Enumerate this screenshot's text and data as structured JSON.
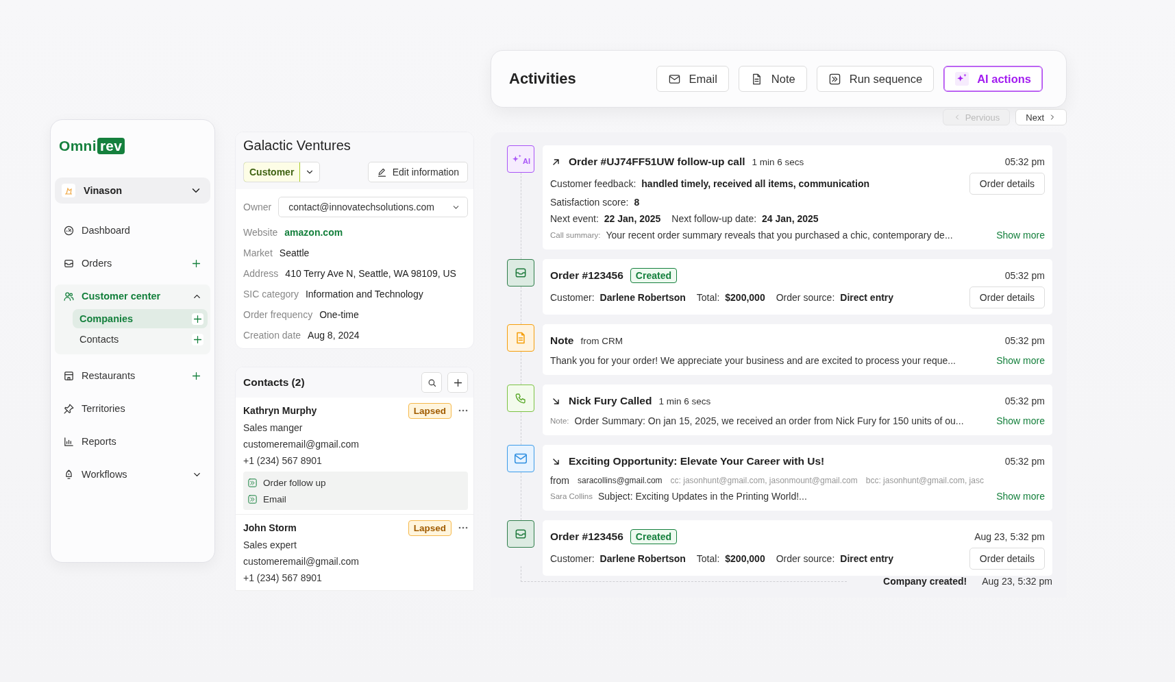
{
  "sidebar": {
    "logo": {
      "part_1": "Omni",
      "part_2": "rev"
    },
    "workspace": {
      "name": "Vinason"
    },
    "items": [
      {
        "label": "Dashboard",
        "selected": false,
        "addable": false
      },
      {
        "label": "Orders",
        "selected": false,
        "addable": true
      },
      {
        "label": "Customer center",
        "selected": true,
        "addable": false,
        "expanded": true,
        "children": [
          {
            "label": "Companies",
            "selected": true,
            "addable": true
          },
          {
            "label": "Contacts",
            "selected": false,
            "addable": true
          }
        ]
      },
      {
        "label": "Restaurants",
        "selected": false,
        "addable": true
      },
      {
        "label": "Territories",
        "selected": false,
        "addable": false
      },
      {
        "label": "Reports",
        "selected": false,
        "addable": false
      },
      {
        "label": "Workflows",
        "selected": false,
        "addable": false,
        "expanded": false
      }
    ]
  },
  "company": {
    "title": "Galactic Ventures",
    "status": "Customer",
    "edit_button": "Edit information",
    "fields": [
      {
        "kind": "select",
        "label": "Owner",
        "value": "contact@innovatechsolutions.com"
      },
      {
        "kind": "link",
        "label": "Website",
        "value": "amazon.com"
      },
      {
        "kind": "text",
        "label": "Market",
        "value": "Seattle"
      },
      {
        "kind": "text",
        "label": "Address",
        "value": "410 Terry Ave N, Seattle, WA 98109, US"
      },
      {
        "kind": "text",
        "label": "SIC category",
        "value": "Information and Technology"
      },
      {
        "kind": "text",
        "label": "Order frequency",
        "value": "One-time"
      },
      {
        "kind": "text",
        "label": "Creation date",
        "value": "Aug 8, 2024"
      }
    ]
  },
  "contacts": {
    "title": "Contacts (2)",
    "items": [
      {
        "name": "Kathryn Murphy",
        "badge": "Lapsed",
        "role": "Sales manger",
        "email": "customeremail@gmail.com",
        "phone": "+1 (234) 567 8901",
        "sequences": [
          "Order follow up",
          "Email"
        ]
      },
      {
        "name": "John Storm",
        "badge": "Lapsed",
        "role": "Sales expert",
        "email": "customeremail@gmail.com",
        "phone": "+1 (234) 567 8901"
      }
    ]
  },
  "activities": {
    "title": "Activities",
    "actions": [
      {
        "label": "Email",
        "highlighted": false
      },
      {
        "label": "Note",
        "highlighted": false
      },
      {
        "label": "Run sequence",
        "highlighted": false
      },
      {
        "label": "AI actions",
        "highlighted": true
      }
    ],
    "pagination": [
      {
        "label": "Pervious",
        "disabled": true
      },
      {
        "label": "Next",
        "disabled": false
      }
    ],
    "entries": [
      {
        "kind": "ai",
        "marker_text": "AI",
        "outgoing": true,
        "title": "Order #UJ74FF51UW follow-up call",
        "meta": "1 min 6 secs",
        "time": "05:32 pm",
        "button": "Order details",
        "rows": [
          [
            {
              "label": "Customer feedback:",
              "value": "handled timely, received all items, communication"
            }
          ],
          [
            {
              "label": "Satisfaction score:",
              "value": "8"
            }
          ],
          [
            {
              "label": "Next event:",
              "value": "22 Jan, 2025"
            },
            {
              "label": "Next follow-up date:",
              "value": "24 Jan, 2025"
            }
          ]
        ],
        "summary_label": "Call summary:",
        "summary": "Your recent order summary reveals that you purchased a chic, contemporary de...",
        "more": "Show more"
      },
      {
        "kind": "order",
        "title": "Order #123456",
        "status": "Created",
        "time": "05:32 pm",
        "button": "Order details",
        "rows": [
          [
            {
              "label": "Customer:",
              "value": "Darlene Robertson"
            },
            {
              "label": "Total:",
              "value": "$200,000"
            },
            {
              "label": "Order source:",
              "value": "Direct entry"
            }
          ]
        ]
      },
      {
        "kind": "note",
        "title": "Note",
        "meta": "from CRM",
        "time": "05:32 pm",
        "summary": "Thank you for your order! We appreciate your business and are excited to process your reque...",
        "more": "Show more"
      },
      {
        "kind": "call",
        "outgoing": false,
        "title": "Nick Fury Called",
        "meta": "1 min 6 secs",
        "time": "05:32 pm",
        "summary_label": "Note:",
        "summary": "Order Summary: On jan 15, 2025, we received an order from Nick Fury for 150 units of ou...",
        "more": "Show more"
      },
      {
        "kind": "email",
        "outgoing": false,
        "title": "Exciting Opportunity: Elevate Your Career with Us!",
        "time": "05:32 pm",
        "from_label": "from",
        "from": "saracollins@gmail.com",
        "cc": "cc: jasonhunt@gmail.com, jasonmount@gmail.com",
        "bcc": "bcc: jasonhunt@gmail.com, jasc",
        "summary_label": "Sara Collins",
        "summary": "Subject: Exciting Updates in the Printing World!...",
        "more": "Show more"
      },
      {
        "kind": "order",
        "title": "Order #123456",
        "status": "Created",
        "time": "Aug 23, 5:32 pm",
        "button": "Order details",
        "rows": [
          [
            {
              "label": "Customer:",
              "value": "Darlene Robertson"
            },
            {
              "label": "Total:",
              "value": "$200,000"
            },
            {
              "label": "Order source:",
              "value": "Direct entry"
            }
          ]
        ]
      }
    ],
    "footer": {
      "label": "Company created!",
      "time": "Aug 23, 5:32 pm"
    }
  }
}
